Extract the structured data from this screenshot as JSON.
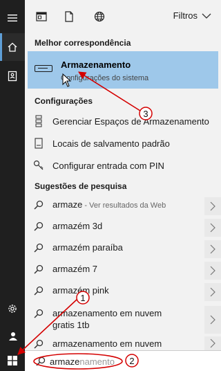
{
  "toolbar": {
    "filters_label": "Filtros"
  },
  "best_match": {
    "heading": "Melhor correspondência",
    "title": "Armazenamento",
    "subtitle": "Configurações do sistema"
  },
  "settings": {
    "heading": "Configurações",
    "items": [
      {
        "label": "Gerenciar Espaços de Armazenamento"
      },
      {
        "label": "Locais de salvamento padrão"
      },
      {
        "label": "Configurar entrada com PIN"
      }
    ]
  },
  "suggestions": {
    "heading": "Sugestões de pesquisa",
    "items": [
      {
        "query": "armaze",
        "hint": " - Ver resultados da Web"
      },
      {
        "query": "armazém 3d"
      },
      {
        "query": "armazém paraíba"
      },
      {
        "query": "armazém 7"
      },
      {
        "query": "armazém pink"
      },
      {
        "query": "armazenamento em nuvem gratis 1tb"
      },
      {
        "query": "armazenamento em nuvem"
      }
    ]
  },
  "search": {
    "typed": "armaze",
    "placeholder_rest": "namento"
  },
  "annotations": {
    "marker_1": "1",
    "marker_2": "2",
    "marker_3": "3"
  },
  "colors": {
    "highlight": "#9ec8ea",
    "annotation": "#d40000",
    "rail": "#1f1f1f"
  }
}
